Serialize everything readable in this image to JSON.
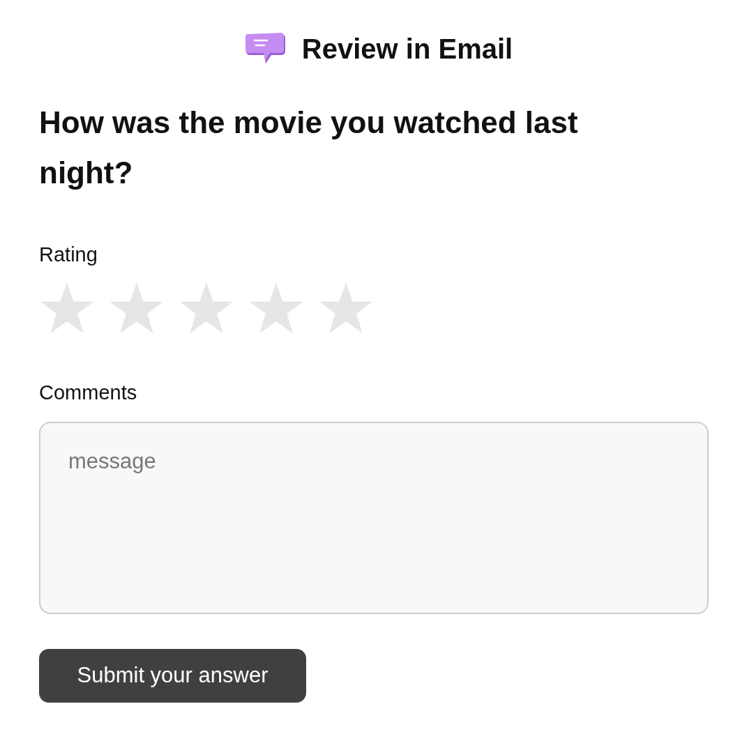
{
  "header": {
    "title": "Review in Email"
  },
  "question": "How was the movie you watched last night?",
  "rating": {
    "label": "Rating",
    "stars": 0
  },
  "comments": {
    "label": "Comments",
    "placeholder": "message"
  },
  "submit_button": "Submit your answer"
}
